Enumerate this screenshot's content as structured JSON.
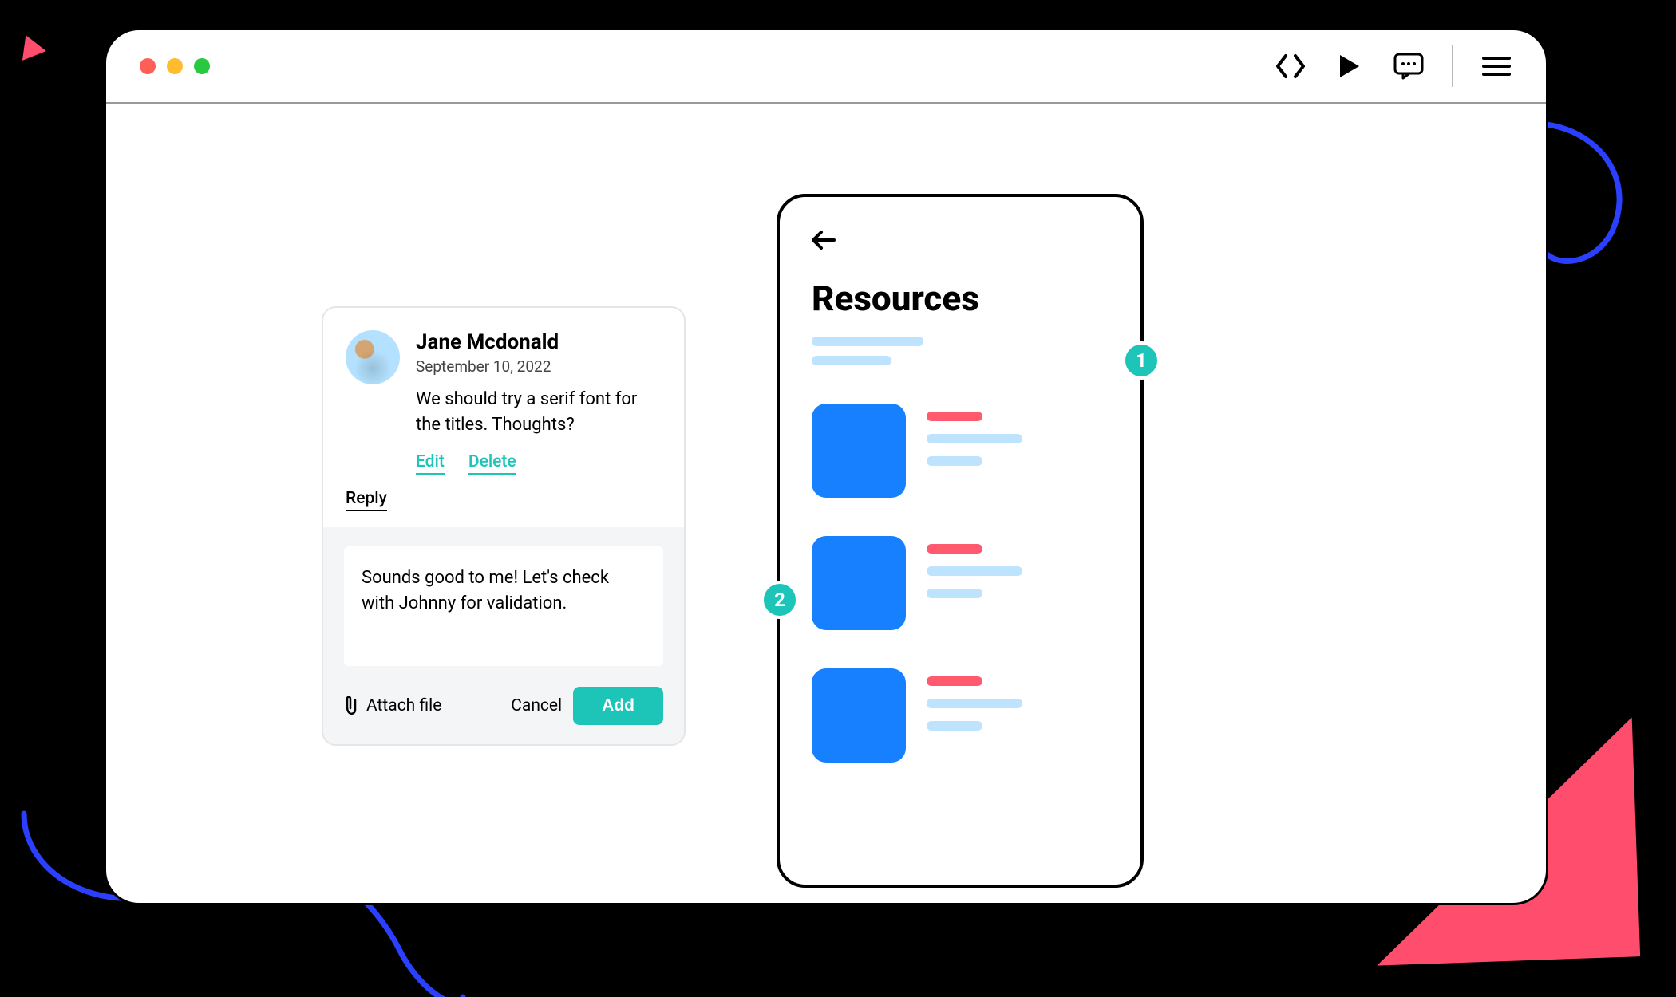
{
  "toolbar": {
    "code_icon": "code-icon",
    "play_icon": "play-icon",
    "comment_icon": "comment-icon",
    "menu_icon": "menu-icon"
  },
  "comment": {
    "author": "Jane Mcdonald",
    "date": "September 10, 2022",
    "body": "We should try a serif font for the titles. Thoughts?",
    "edit_label": "Edit",
    "delete_label": "Delete",
    "reply_label": "Reply"
  },
  "reply": {
    "text": "Sounds good to me! Let's check with Johnny for validation.",
    "attach_label": "Attach file",
    "cancel_label": "Cancel",
    "add_label": "Add"
  },
  "phone": {
    "title": "Resources"
  },
  "annotations": {
    "badge1": "1",
    "badge2": "2"
  },
  "colors": {
    "accent": "#1cc5b7",
    "link_blue": "#1780ff",
    "danger": "#ff5a6e",
    "squiggle": "#2b3fff"
  }
}
